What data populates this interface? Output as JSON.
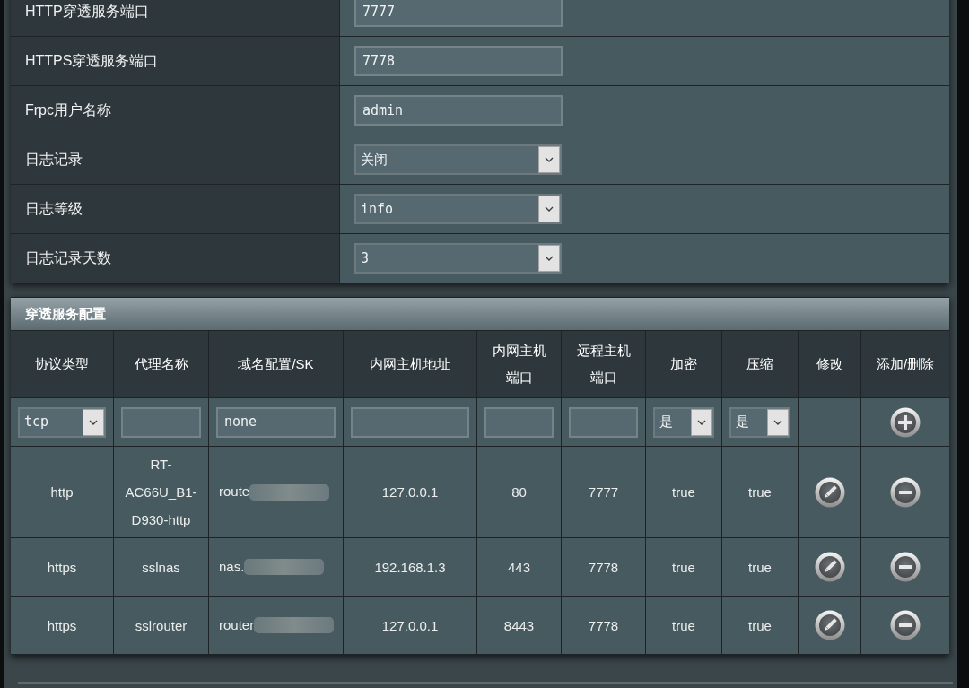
{
  "settings": [
    {
      "label": "HTTP穿透服务端口",
      "kind": "input",
      "value": "7777"
    },
    {
      "label": "HTTPS穿透服务端口",
      "kind": "input",
      "value": "7778"
    },
    {
      "label": "Frpc用户名称",
      "kind": "input",
      "value": "admin"
    },
    {
      "label": "日志记录",
      "kind": "select",
      "value": "关闭"
    },
    {
      "label": "日志等级",
      "kind": "select",
      "value": "info"
    },
    {
      "label": "日志记录天数",
      "kind": "select",
      "value": "3"
    }
  ],
  "proxy_table": {
    "title": "穿透服务配置",
    "columns": [
      "协议类型",
      "代理名称",
      "域名配置/SK",
      "内网主机地址",
      "内网主机端口",
      "远程主机端口",
      "加密",
      "压缩",
      "修改",
      "添加/删除"
    ],
    "new_entry": [
      {
        "kind": "select",
        "value": "tcp"
      },
      {
        "kind": "input"
      },
      {
        "kind": "input",
        "value": "none"
      },
      {
        "kind": "input"
      },
      {
        "kind": "input"
      },
      {
        "kind": "input"
      },
      {
        "kind": "select",
        "value": "是"
      },
      {
        "kind": "select",
        "value": "是"
      },
      {
        "kind": "blank"
      },
      {
        "kind": "add"
      }
    ],
    "rows": [
      {
        "protocol": "http",
        "name": "RT-AC66U_B1-D930-http",
        "domain": "route",
        "domain_redacted": true,
        "local_ip": "127.0.0.1",
        "local_port": "80",
        "remote_port": "7777",
        "encrypt": "true",
        "compress": "true"
      },
      {
        "protocol": "https",
        "name": "sslnas",
        "domain": "nas.",
        "domain_redacted": true,
        "local_ip": "192.168.1.3",
        "local_port": "443",
        "remote_port": "7778",
        "encrypt": "true",
        "compress": "true"
      },
      {
        "protocol": "https",
        "name": "sslrouter",
        "domain": "router",
        "domain_redacted": true,
        "local_ip": "127.0.0.1",
        "local_port": "8443",
        "remote_port": "7778",
        "encrypt": "true",
        "compress": "true"
      }
    ]
  }
}
